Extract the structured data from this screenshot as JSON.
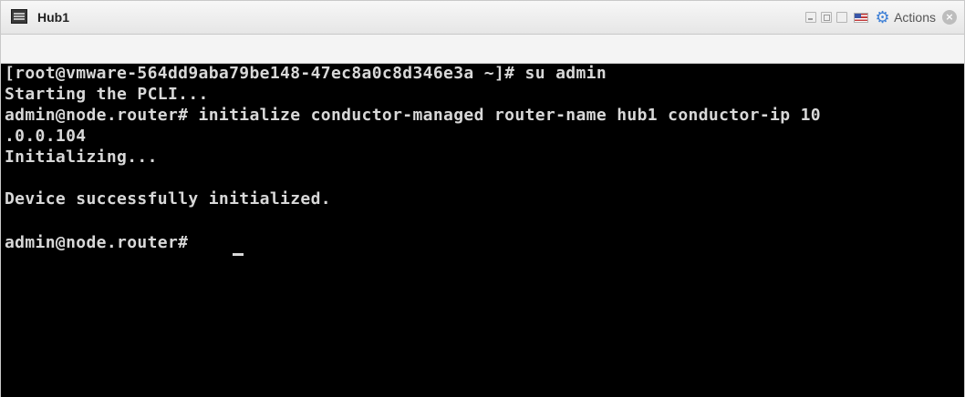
{
  "window": {
    "title": "Hub1",
    "actions_label": "Actions",
    "icons": {
      "console": "console-icon",
      "minimize": "minimize-icon",
      "restore": "restore-icon",
      "maximize": "maximize-icon",
      "keyboard_lang": "us-flag-icon",
      "actions": "gear-icon",
      "close": "close-icon"
    }
  },
  "terminal": {
    "lines": [
      "[root@vmware-564dd9aba79be148-47ec8a0c8d346e3a ~]# su admin",
      "Starting the PCLI...",
      "admin@node.router# initialize conductor-managed router-name hub1 conductor-ip 10",
      ".0.0.104",
      "Initializing...",
      "",
      "Device successfully initialized.",
      "",
      "admin@node.router# "
    ]
  },
  "colors": {
    "terminal_bg": "#000000",
    "terminal_fg": "#d8d8d8",
    "accent": "#3d7fd6"
  }
}
